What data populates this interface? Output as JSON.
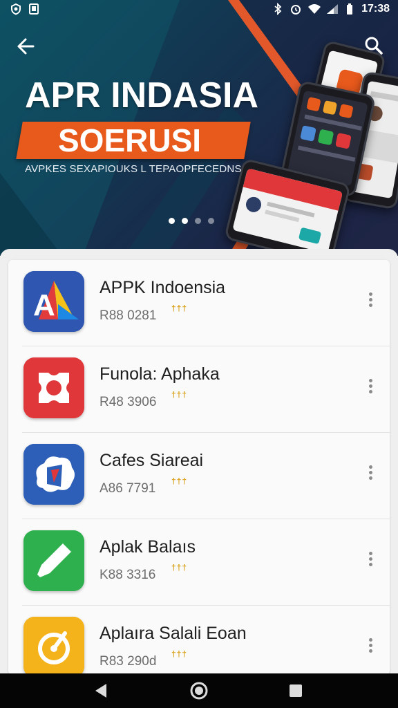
{
  "status_bar": {
    "time": "17:38",
    "left_icons": [
      "sync-icon",
      "storage-icon"
    ],
    "right_icons": [
      "bluetooth-icon",
      "alarm-icon",
      "wifi-icon",
      "signal-icon",
      "battery-icon"
    ]
  },
  "header": {
    "back_icon": "arrow-left-icon",
    "search_icon": "search-icon"
  },
  "banner": {
    "title": "APR INDASIA",
    "ribbon_text": "SOERUSI",
    "caption": "AVPKES SEXAPIOUKS L TEPAOPFECEDNS",
    "slide_count": 4,
    "active_slide": 2,
    "accent_color": "#e8591c"
  },
  "apps": [
    {
      "name": "APPK Indoensia",
      "meta": "R88 0281",
      "rating_mark": "†††",
      "icon": "apk-indonesia-icon",
      "icon_color": "#2f56b0"
    },
    {
      "name": "Funola: Aphaka",
      "meta": "R48 3906",
      "rating_mark": "†††",
      "icon": "funola-icon",
      "icon_color": "#e0383a"
    },
    {
      "name": "Cafes Siareai",
      "meta": "A86 7791",
      "rating_mark": "†††",
      "icon": "cafes-siareai-icon",
      "icon_color": "#2d5fb8"
    },
    {
      "name": "Aplak Balaıs",
      "meta": "K88 3316",
      "rating_mark": "†††",
      "icon": "aplak-balais-icon",
      "icon_color": "#2eb04f"
    },
    {
      "name": "Aplaıra Salali Eoan",
      "meta": "R83 290d",
      "rating_mark": "†††",
      "icon": "aplaira-salali-icon",
      "icon_color": "#f4b21b"
    }
  ],
  "nav_bar": {
    "buttons": [
      "back-triangle-icon",
      "home-circle-icon",
      "recents-square-icon"
    ]
  }
}
